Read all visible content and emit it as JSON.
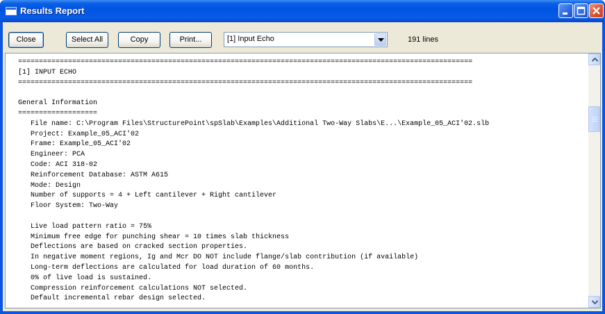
{
  "window": {
    "title": "Results Report"
  },
  "toolbar": {
    "close_label": "Close",
    "select_all_label": "Select All",
    "copy_label": "Copy",
    "print_label": "Print...",
    "report_select_value": "[1] Input Echo",
    "line_count": "191 lines"
  },
  "report": {
    "lines": [
      "=============================================================================================================",
      "[1] INPUT ECHO",
      "=============================================================================================================",
      "",
      "General Information",
      "===================",
      "   File name: C:\\Program Files\\StructurePoint\\spSlab\\Examples\\Additional Two-Way Slabs\\E...\\Example_05_ACI'02.slb",
      "   Project: Example_05_ACI'02",
      "   Frame: Example_05_ACI'02",
      "   Engineer: PCA",
      "   Code: ACI 318-02",
      "   Reinforcement Database: ASTM A615",
      "   Mode: Design",
      "   Number of supports = 4 + Left cantilever + Right cantilever",
      "   Floor System: Two-Way",
      "",
      "   Live load pattern ratio = 75%",
      "   Minimum free edge for punching shear = 10 times slab thickness",
      "   Deflections are based on cracked section properties.",
      "   In negative moment regions, Ig and Mcr DO NOT include flange/slab contribution (if available)",
      "   Long-term deflections are calculated for load duration of 60 months.",
      "   0% of live load is sustained.",
      "   Compression reinforcement calculations NOT selected.",
      "   Default incremental rebar design selected."
    ]
  },
  "icons": {
    "title": "window-icon",
    "minimize": "minimize-icon",
    "maximize": "maximize-icon",
    "close": "close-icon",
    "dropdown": "chevron-down-icon",
    "scroll_up": "arrow-up-icon",
    "scroll_down": "arrow-down-icon"
  },
  "colors": {
    "titlebar": "#0054e3",
    "close_button": "#d8553a",
    "dialog_background": "#ece9d8"
  }
}
